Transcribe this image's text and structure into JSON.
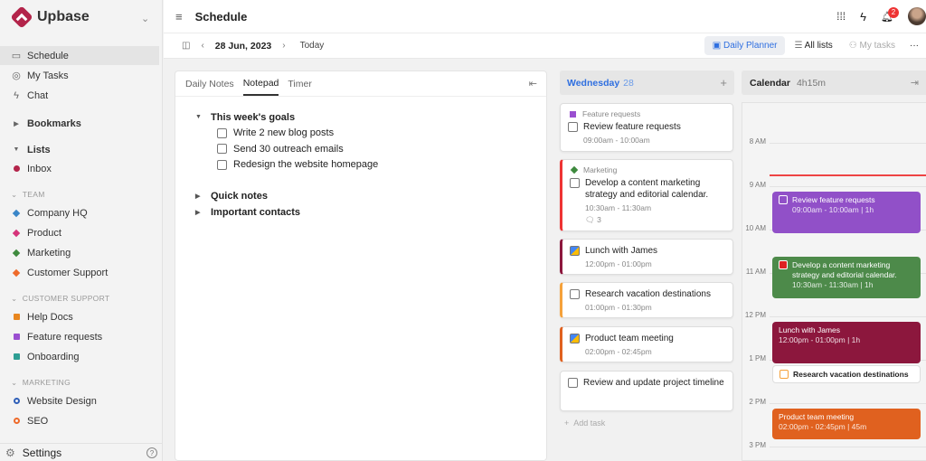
{
  "app": {
    "name": "Upbase"
  },
  "sidebar": {
    "main": [
      {
        "label": "Schedule",
        "icon": "calendar-icon"
      },
      {
        "label": "My Tasks",
        "icon": "check-circle-icon"
      },
      {
        "label": "Chat",
        "icon": "bolt-icon"
      }
    ],
    "bookmarks": "Bookmarks",
    "lists": "Lists",
    "inbox": "Inbox",
    "groups": [
      {
        "label": "TEAM",
        "items": [
          {
            "label": "Company HQ",
            "color": "#3a86c8"
          },
          {
            "label": "Product",
            "color": "#d6337a"
          },
          {
            "label": "Marketing",
            "color": "#3e8a3e"
          },
          {
            "label": "Customer Support",
            "color": "#ee6a2a"
          }
        ]
      },
      {
        "label": "CUSTOMER SUPPORT",
        "items": [
          {
            "label": "Help Docs",
            "color": "#e8861f"
          },
          {
            "label": "Feature requests",
            "color": "#9a4fd0"
          },
          {
            "label": "Onboarding",
            "color": "#2e9e93"
          }
        ]
      },
      {
        "label": "MARKETING",
        "items": [
          {
            "label": "Website Design",
            "color": "#2f5fb8"
          },
          {
            "label": "SEO",
            "color": "#ee6a2a"
          }
        ]
      }
    ],
    "settings": "Settings"
  },
  "header": {
    "title": "Schedule",
    "notifications": "2"
  },
  "toolbar": {
    "date": "28 Jun, 2023",
    "today": "Today",
    "daily_planner": "Daily Planner",
    "all_lists": "All lists",
    "my_tasks": "My tasks"
  },
  "notepad": {
    "tabs": [
      "Daily Notes",
      "Notepad",
      "Timer"
    ],
    "active_tab": "Notepad",
    "goals": "This week's goals",
    "items": [
      "Write 2 new blog posts",
      "Send 30 outreach emails",
      "Redesign the website homepage"
    ],
    "quick": "Quick notes",
    "contacts": "Important contacts"
  },
  "day": {
    "name": "Wednesday",
    "num": "28",
    "add_task": "Add task",
    "tasks": [
      {
        "list": "Feature requests",
        "title": "Review feature requests",
        "time": "09:00am - 10:00am"
      },
      {
        "list": "Marketing",
        "title": "Develop a content marketing strategy and editorial calendar.",
        "time": "10:30am - 11:30am",
        "comments": "3"
      },
      {
        "title": "Lunch with James",
        "time": "12:00pm - 01:00pm"
      },
      {
        "title": "Research vacation destinations",
        "time": "01:00pm - 01:30pm"
      },
      {
        "title": "Product team meeting",
        "time": "02:00pm - 02:45pm"
      },
      {
        "title": "Review and update project timeline"
      }
    ]
  },
  "calendar": {
    "title": "Calendar",
    "duration": "4h15m",
    "hours": [
      "8 AM",
      "9 AM",
      "10 AM",
      "11 AM",
      "12 PM",
      "1 PM",
      "2 PM",
      "3 PM"
    ],
    "events": [
      {
        "title": "Review feature requests",
        "sub": "09:00am - 10:00am | 1h",
        "color": "#9150c8"
      },
      {
        "title": "Develop a content marketing strategy and editorial calendar.",
        "sub": "10:30am - 11:30am | 1h",
        "color": "#4d8a4a"
      },
      {
        "title": "Lunch with James",
        "sub": "12:00pm - 01:00pm | 1h",
        "color": "#8c173d"
      },
      {
        "title": "Research vacation destinations"
      },
      {
        "title": "Product team meeting",
        "sub": "02:00pm - 02:45pm | 45m",
        "color": "#e0611f"
      }
    ]
  }
}
